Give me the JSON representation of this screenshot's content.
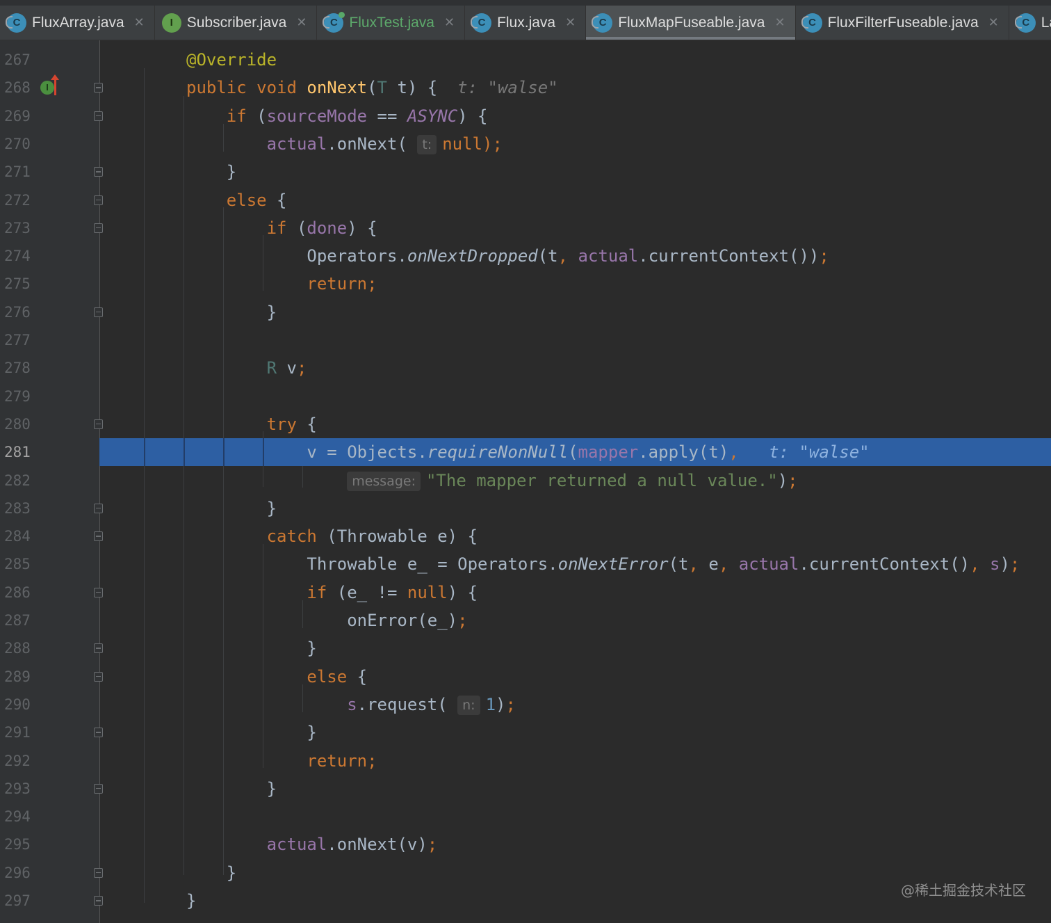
{
  "tabs": [
    {
      "label": "FluxArray.java",
      "icon": "class-file-icon"
    },
    {
      "label": "Subscriber.java",
      "icon": "interface-file-icon"
    },
    {
      "label": "FluxTest.java",
      "icon": "test-file-icon"
    },
    {
      "label": "Flux.java",
      "icon": "class-file-icon"
    },
    {
      "label": "FluxMapFuseable.java",
      "icon": "class-file-icon",
      "active": true
    },
    {
      "label": "FluxFilterFuseable.java",
      "icon": "class-file-icon"
    },
    {
      "label": "La",
      "icon": "class-file-icon"
    }
  ],
  "gutter": {
    "line_numbers": [
      "267",
      "268",
      "269",
      "270",
      "271",
      "272",
      "273",
      "274",
      "275",
      "276",
      "277",
      "278",
      "279",
      "280",
      "281",
      "282",
      "283",
      "284",
      "285",
      "286",
      "287",
      "288",
      "289",
      "290",
      "291",
      "292",
      "293",
      "294",
      "295",
      "296",
      "297"
    ],
    "current_line": "281",
    "override_marker": "I"
  },
  "inline_values": {
    "line_268": "t: \"walse\"",
    "line_281": "t: \"walse\""
  },
  "param_hints": {
    "line_270": "t:",
    "line_282": "message:",
    "line_290": "n:"
  },
  "watermark": "@稀土掘金技术社区",
  "colors": {
    "background": "#2b2b2b",
    "gutter": "#313335",
    "current_line_highlight": "#2d5fa3",
    "keyword": "#cc7832",
    "string": "#6a8759",
    "field": "#9876aa"
  }
}
